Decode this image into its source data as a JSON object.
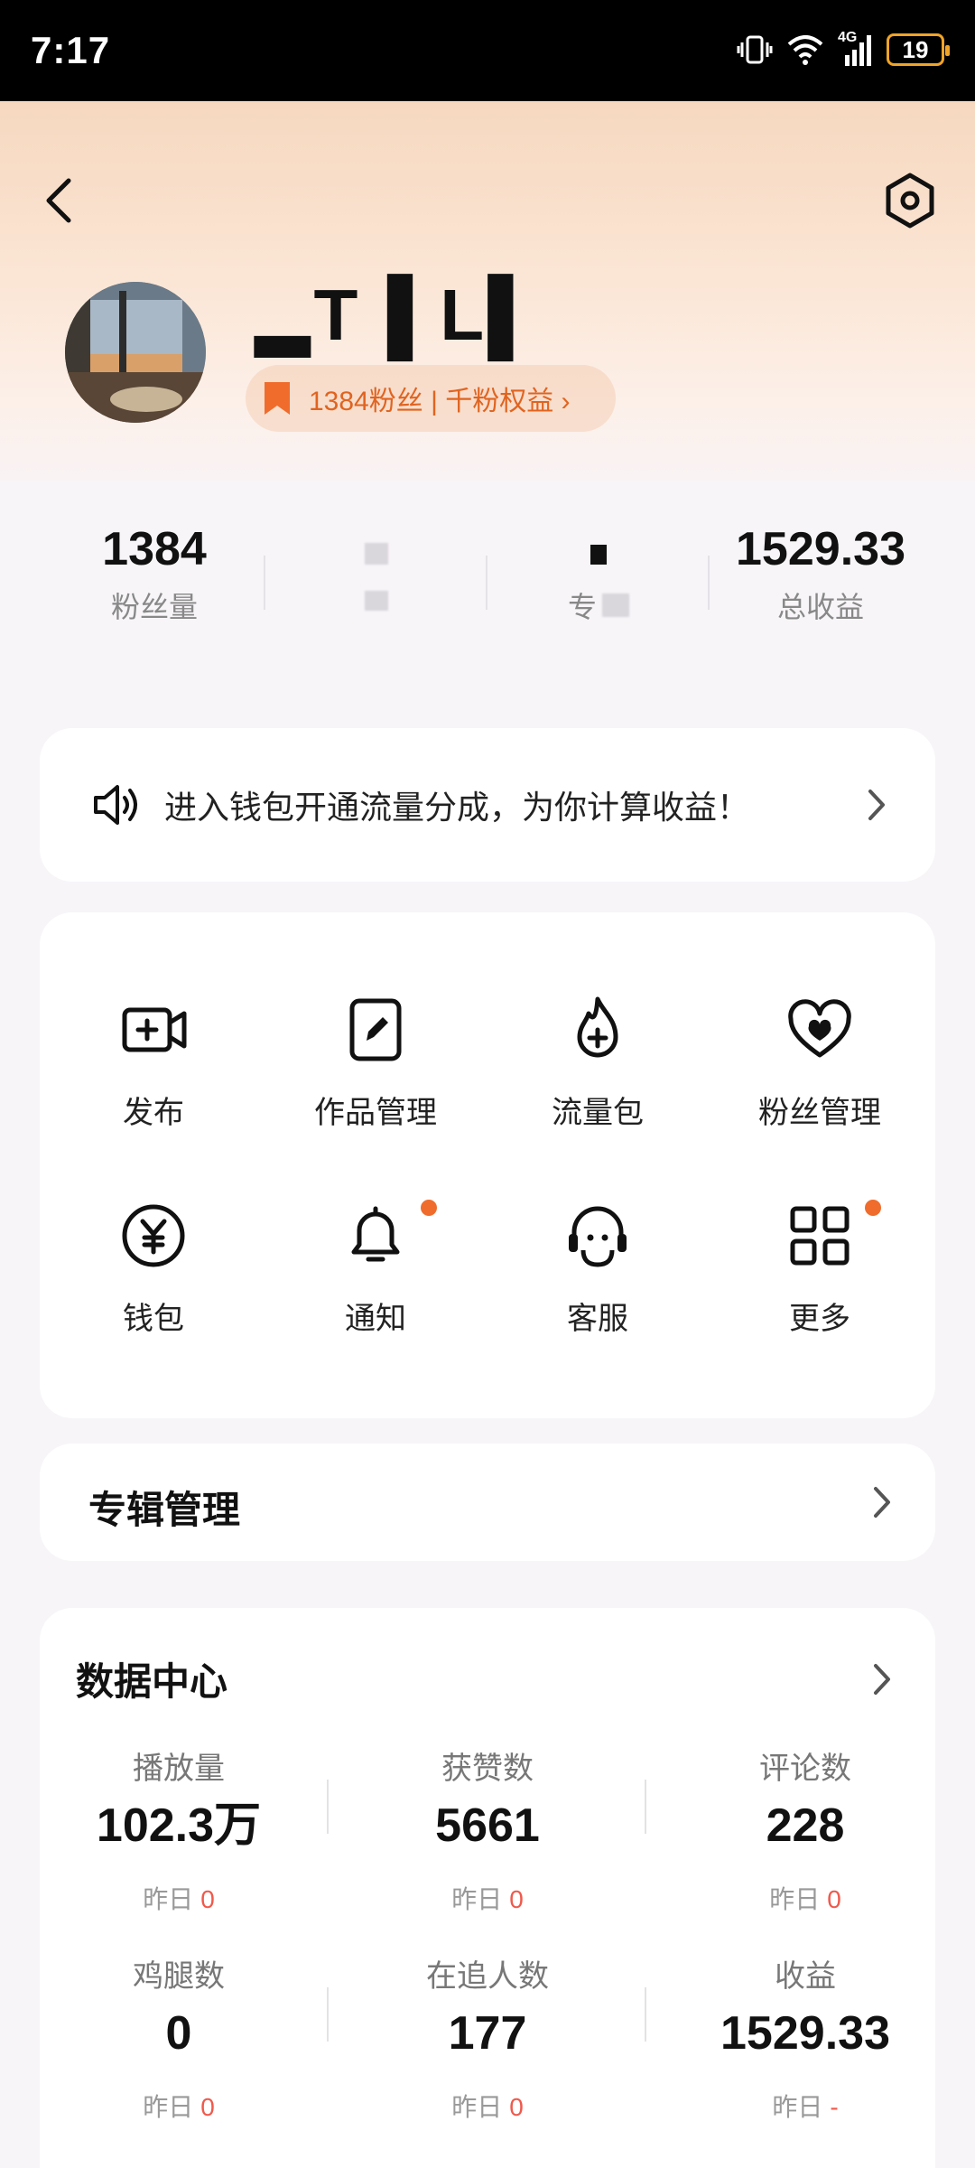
{
  "status_bar": {
    "time": "7:17",
    "network": "4G",
    "battery": "19"
  },
  "profile": {
    "username": "▂T▐ L▌",
    "fans_badge": "1384粉丝 | 千粉权益 ›"
  },
  "stats": [
    {
      "value": "1384",
      "label": "粉丝量"
    },
    {
      "value": "",
      "label": ""
    },
    {
      "value": "",
      "label": "专"
    },
    {
      "value": "1529.33",
      "label": "总收益"
    }
  ],
  "notice": {
    "text": "进入钱包开通流量分成，为你计算收益！"
  },
  "grid": [
    {
      "label": "发布",
      "icon": "video-add-icon",
      "badge": false
    },
    {
      "label": "作品管理",
      "icon": "edit-document-icon",
      "badge": false
    },
    {
      "label": "流量包",
      "icon": "flame-plus-icon",
      "badge": false
    },
    {
      "label": "粉丝管理",
      "icon": "heart-icon",
      "badge": false
    },
    {
      "label": "钱包",
      "icon": "yen-coin-icon",
      "badge": false
    },
    {
      "label": "通知",
      "icon": "bell-icon",
      "badge": true
    },
    {
      "label": "客服",
      "icon": "headset-icon",
      "badge": false
    },
    {
      "label": "更多",
      "icon": "grid-icon",
      "badge": true
    }
  ],
  "album": {
    "title": "专辑管理"
  },
  "data_center": {
    "title": "数据中心",
    "yesterday_label": "昨日",
    "metrics": [
      {
        "label": "播放量",
        "value": "102.3万",
        "yesterday": "0"
      },
      {
        "label": "获赞数",
        "value": "5661",
        "yesterday": "0"
      },
      {
        "label": "评论数",
        "value": "228",
        "yesterday": "0"
      },
      {
        "label": "鸡腿数",
        "value": "0",
        "yesterday": "0"
      },
      {
        "label": "在追人数",
        "value": "177",
        "yesterday": "0"
      },
      {
        "label": "收益",
        "value": "1529.33",
        "yesterday": "-"
      }
    ]
  },
  "colors": {
    "accent": "#e06420",
    "badge_dot": "#f06c2c",
    "yesterday_num": "#ef5a4c"
  }
}
